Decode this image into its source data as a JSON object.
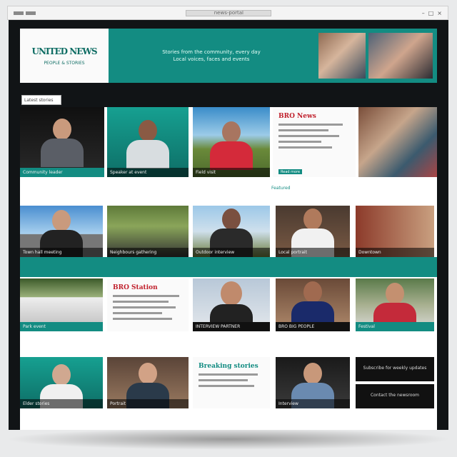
{
  "browser": {
    "address": "news-portal",
    "controls": [
      "–",
      "□",
      "×"
    ]
  },
  "header": {
    "logo_text": "UNITED NEWS",
    "logo_sub": "PEOPLE & STORIES",
    "tagline_line1": "Stories from the community, every day",
    "tagline_line2": "Local voices, faces and events"
  },
  "nav": {
    "label": "Latest stories"
  },
  "row1": {
    "tile1_caption": "Community leader",
    "tile2_caption": "Speaker at event",
    "tile3_caption": "Field visit",
    "article_title": "BRO News",
    "article_link": "Read more"
  },
  "row2": {
    "section_label": "Featured",
    "tile1_caption": "Town hall meeting",
    "tile2_caption": "Neighbours gathering",
    "tile3_caption": "Outdoor interview",
    "tile4_caption": "Local portrait",
    "tile5_caption": "Downtown"
  },
  "row3": {
    "tile1_caption": "Park event",
    "article_title": "BRO Station",
    "tile3_caption": "INTERVIEW PARTNER",
    "tile4_caption": "BRO BIG PEOPLE",
    "tile5_caption": "Festival"
  },
  "row4": {
    "tile1_caption": "Elder stories",
    "tile2_caption": "Portrait",
    "article_title": "Breaking stories",
    "tile4_caption": "Interview",
    "box1_text": "Subscribe for weekly updates",
    "box2_text": "Contact the newsroom"
  }
}
